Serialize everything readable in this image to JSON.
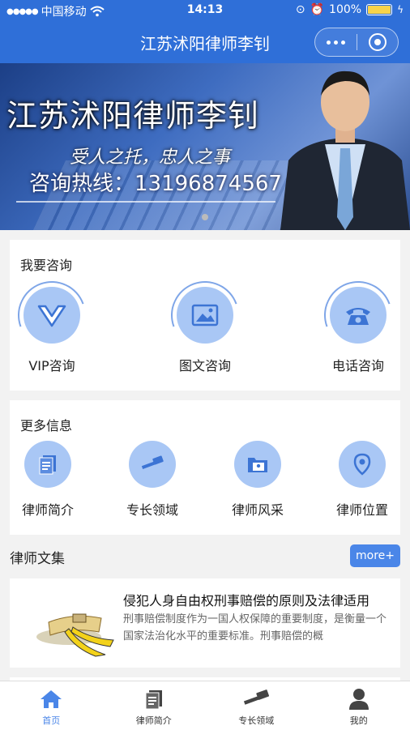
{
  "status_bar": {
    "carrier": "中国移动",
    "time": "14:13",
    "battery": "100%"
  },
  "nav": {
    "title": "江苏沭阳律师李钊"
  },
  "banner": {
    "title": "江苏沭阳律师李钊",
    "slogan": "受人之托，忠人之事",
    "hotline": "咨询热线：13196874567"
  },
  "consult": {
    "heading": "我要咨询",
    "items": [
      {
        "label": "VIP咨询",
        "icon": "vip-v-icon"
      },
      {
        "label": "图文咨询",
        "icon": "image-icon"
      },
      {
        "label": "电话咨询",
        "icon": "telephone-icon"
      }
    ]
  },
  "more_info": {
    "heading": "更多信息",
    "items": [
      {
        "label": "律师简介",
        "icon": "document-icon"
      },
      {
        "label": "专长领域",
        "icon": "gavel-icon"
      },
      {
        "label": "律师风采",
        "icon": "folder-photo-icon"
      },
      {
        "label": "律师位置",
        "icon": "location-pin-icon"
      }
    ]
  },
  "articles": {
    "title": "律师文集",
    "more_label": "more+",
    "items": [
      {
        "title": "侵犯人身自由权刑事赔偿的原则及法律适用",
        "summary": "刑事赔偿制度作为一国人权保障的重要制度，是衡量一个国家法治化水平的重要标准。刑事赔偿的概"
      }
    ]
  },
  "tab_bar": {
    "items": [
      {
        "label": "首页",
        "icon": "home-icon",
        "active": true
      },
      {
        "label": "律师简介",
        "icon": "document-icon",
        "active": false
      },
      {
        "label": "专长领域",
        "icon": "gavel-icon",
        "active": false
      },
      {
        "label": "我的",
        "icon": "user-icon",
        "active": false
      }
    ]
  },
  "colors": {
    "primary": "#2f6fd8",
    "accent": "#4a86e8",
    "icon_bg": "#a9c7f5"
  }
}
